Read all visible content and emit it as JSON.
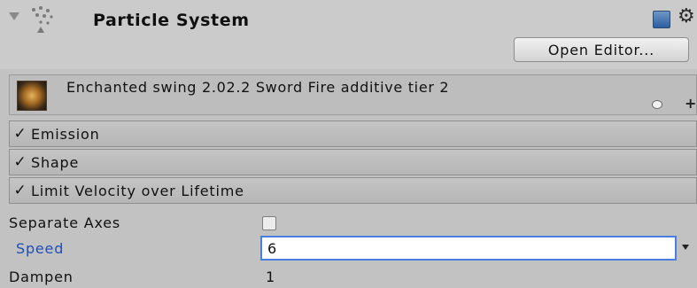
{
  "header": {
    "title": "Particle System",
    "open_editor_label": "Open Editor..."
  },
  "system": {
    "name": "Enchanted swing 2.02.2 Sword Fire additive tier 2",
    "plus": "+"
  },
  "modules": [
    {
      "label": "Emission",
      "check": "✓"
    },
    {
      "label": "Shape",
      "check": "✓"
    },
    {
      "label": "Limit Velocity over Lifetime",
      "check": "✓"
    }
  ],
  "properties": {
    "separate_axes": {
      "label": "Separate Axes",
      "checked": false
    },
    "speed": {
      "label": "Speed",
      "value": "6"
    },
    "dampen": {
      "label": "Dampen",
      "value": "1"
    }
  },
  "icons": {
    "foldout": "triangle-down-icon",
    "particle_system": "particle-system-icon",
    "help": "help-book-icon",
    "gear": "gear-icon",
    "info": "info-icon",
    "dropdown": "dropdown-arrow-icon"
  },
  "colors": {
    "panel_bg": "#c2c2c2",
    "active_label": "#1f4fb5",
    "input_focus": "#4a7fe0"
  }
}
